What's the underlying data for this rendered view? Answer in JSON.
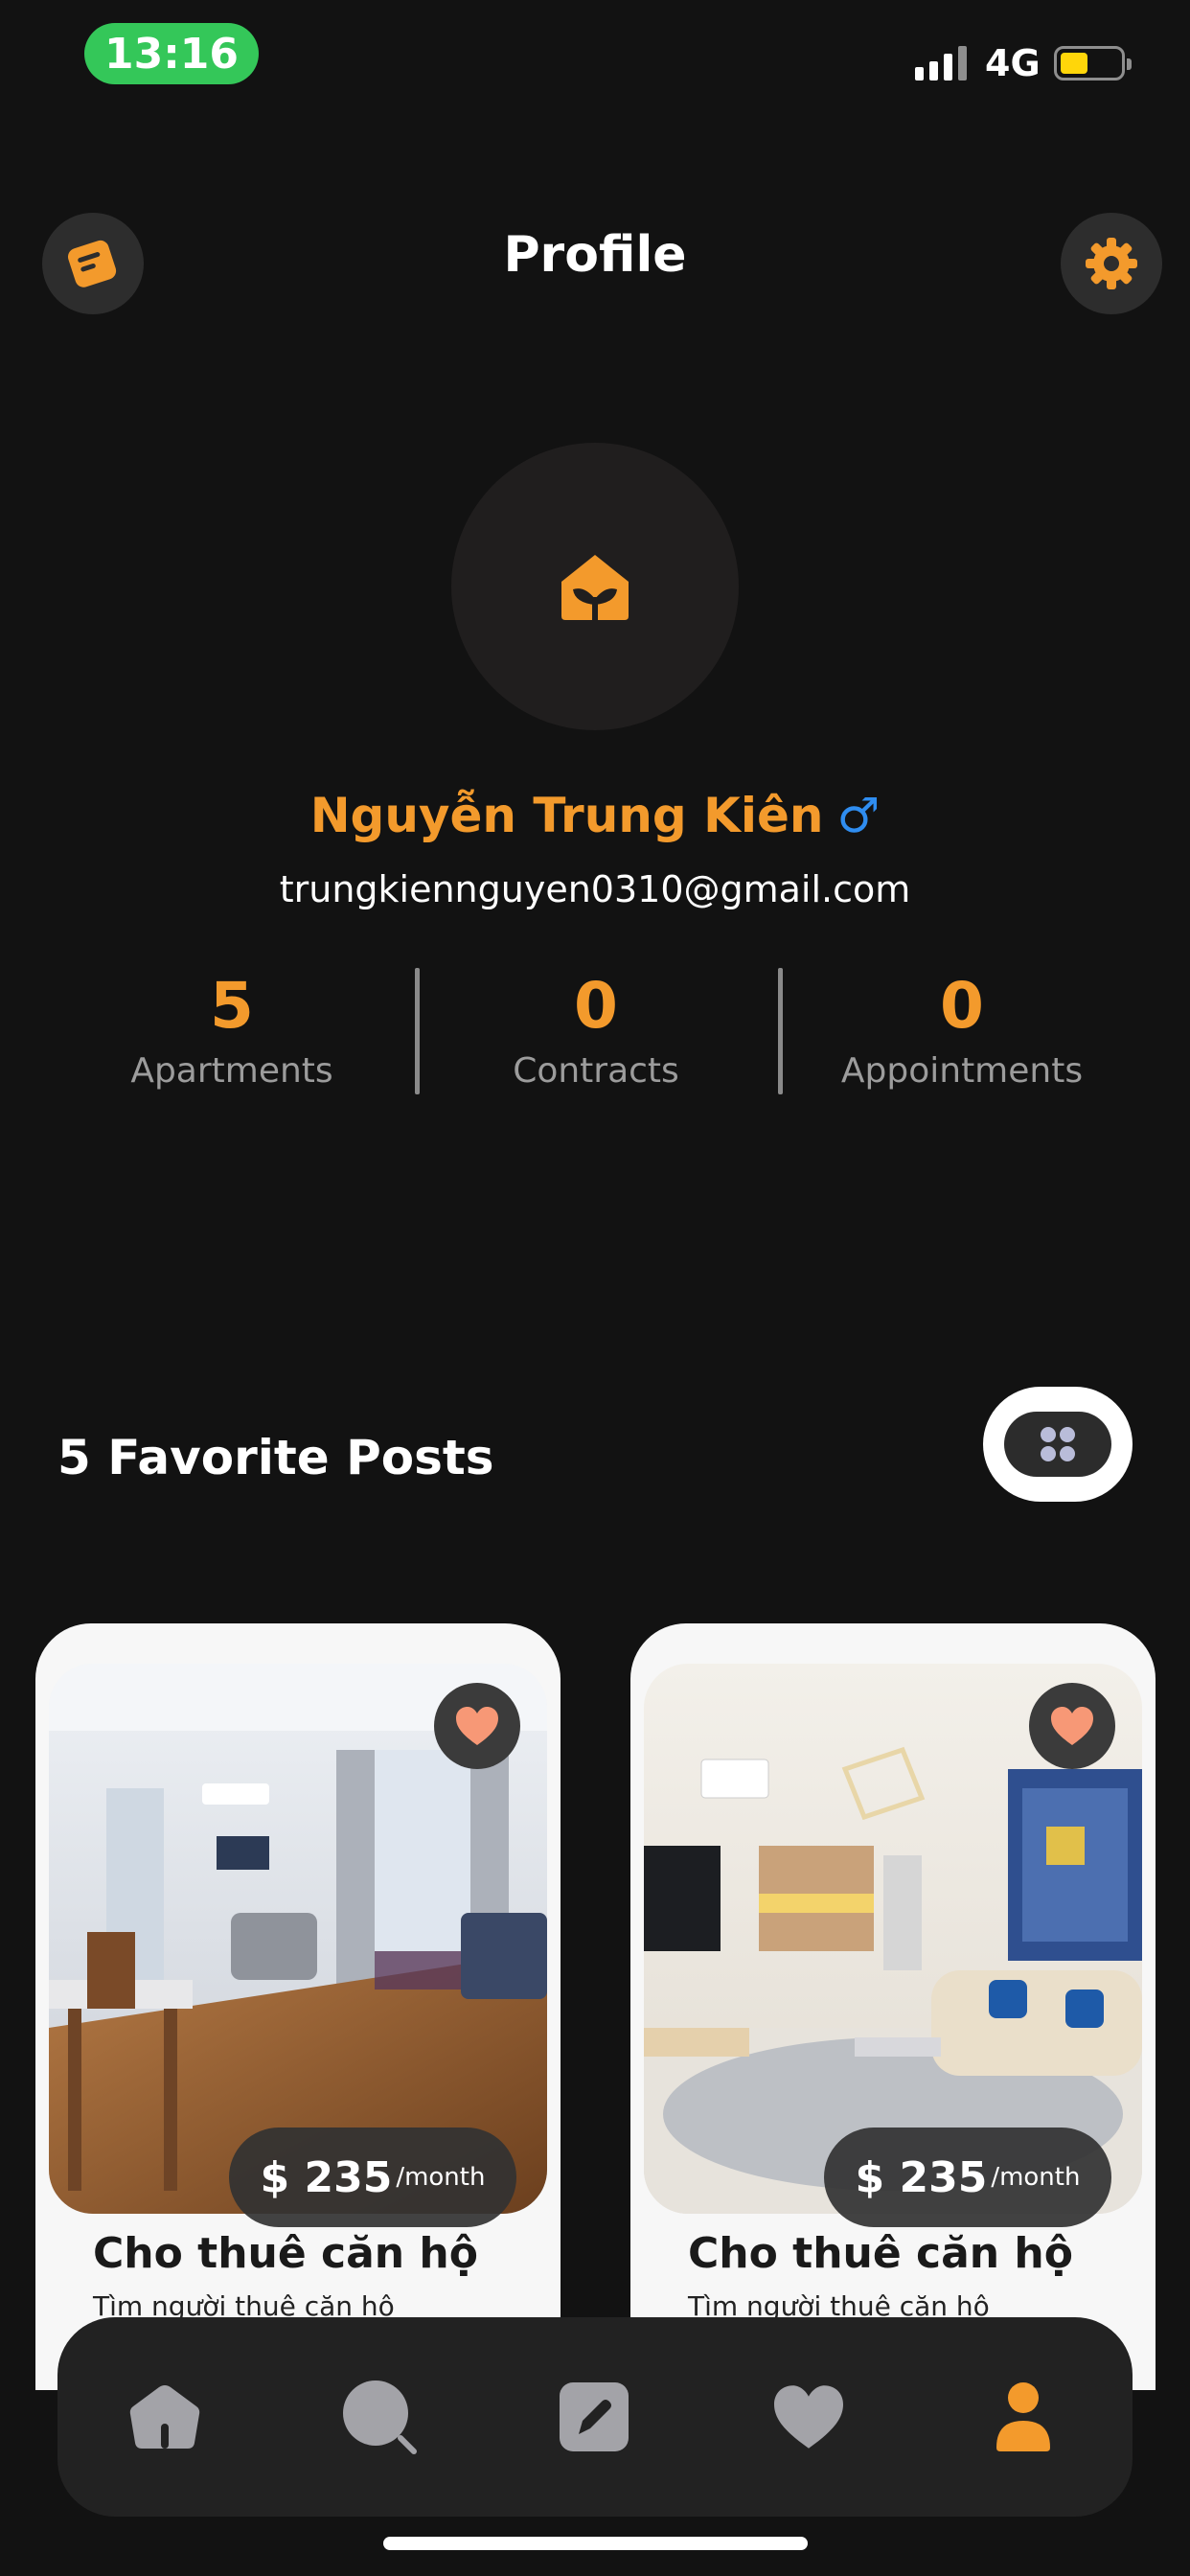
{
  "status_bar": {
    "time": "13:16",
    "network": "4G",
    "battery_level": 0.45
  },
  "header": {
    "title": "Profile",
    "left_icon": "note-icon",
    "right_icon": "gear-icon"
  },
  "profile": {
    "avatar_icon": "home-sprout-icon",
    "name": "Nguyễn Trung Kiên",
    "gender_symbol": "♂",
    "email": "trungkiennguyen0310@gmail.com",
    "stats": [
      {
        "value": "5",
        "label": "Apartments"
      },
      {
        "value": "0",
        "label": "Contracts"
      },
      {
        "value": "0",
        "label": "Appointments"
      }
    ]
  },
  "favorites": {
    "title": "5 Favorite Posts",
    "view_toggle_icon": "grid-icon",
    "posts": [
      {
        "price": "$ 235",
        "unit": "/month",
        "title": "Cho thuê căn hộ",
        "subtitle": "Tìm người thuê căn hộ",
        "favorited": true
      },
      {
        "price": "$ 235",
        "unit": "/month",
        "title": "Cho thuê căn hộ",
        "subtitle": "Tìm người thuê căn hộ",
        "favorited": true
      }
    ]
  },
  "bottom_nav": {
    "items": [
      {
        "icon": "home-icon",
        "active": false
      },
      {
        "icon": "search-icon",
        "active": false
      },
      {
        "icon": "edit-post-icon",
        "active": false
      },
      {
        "icon": "heart-icon",
        "active": false
      },
      {
        "icon": "profile-icon",
        "active": true
      }
    ]
  },
  "colors": {
    "accent": "#f39a2c",
    "background": "#121212",
    "muted": "#9c9c9c",
    "nav_inactive": "#a3a3a8"
  }
}
